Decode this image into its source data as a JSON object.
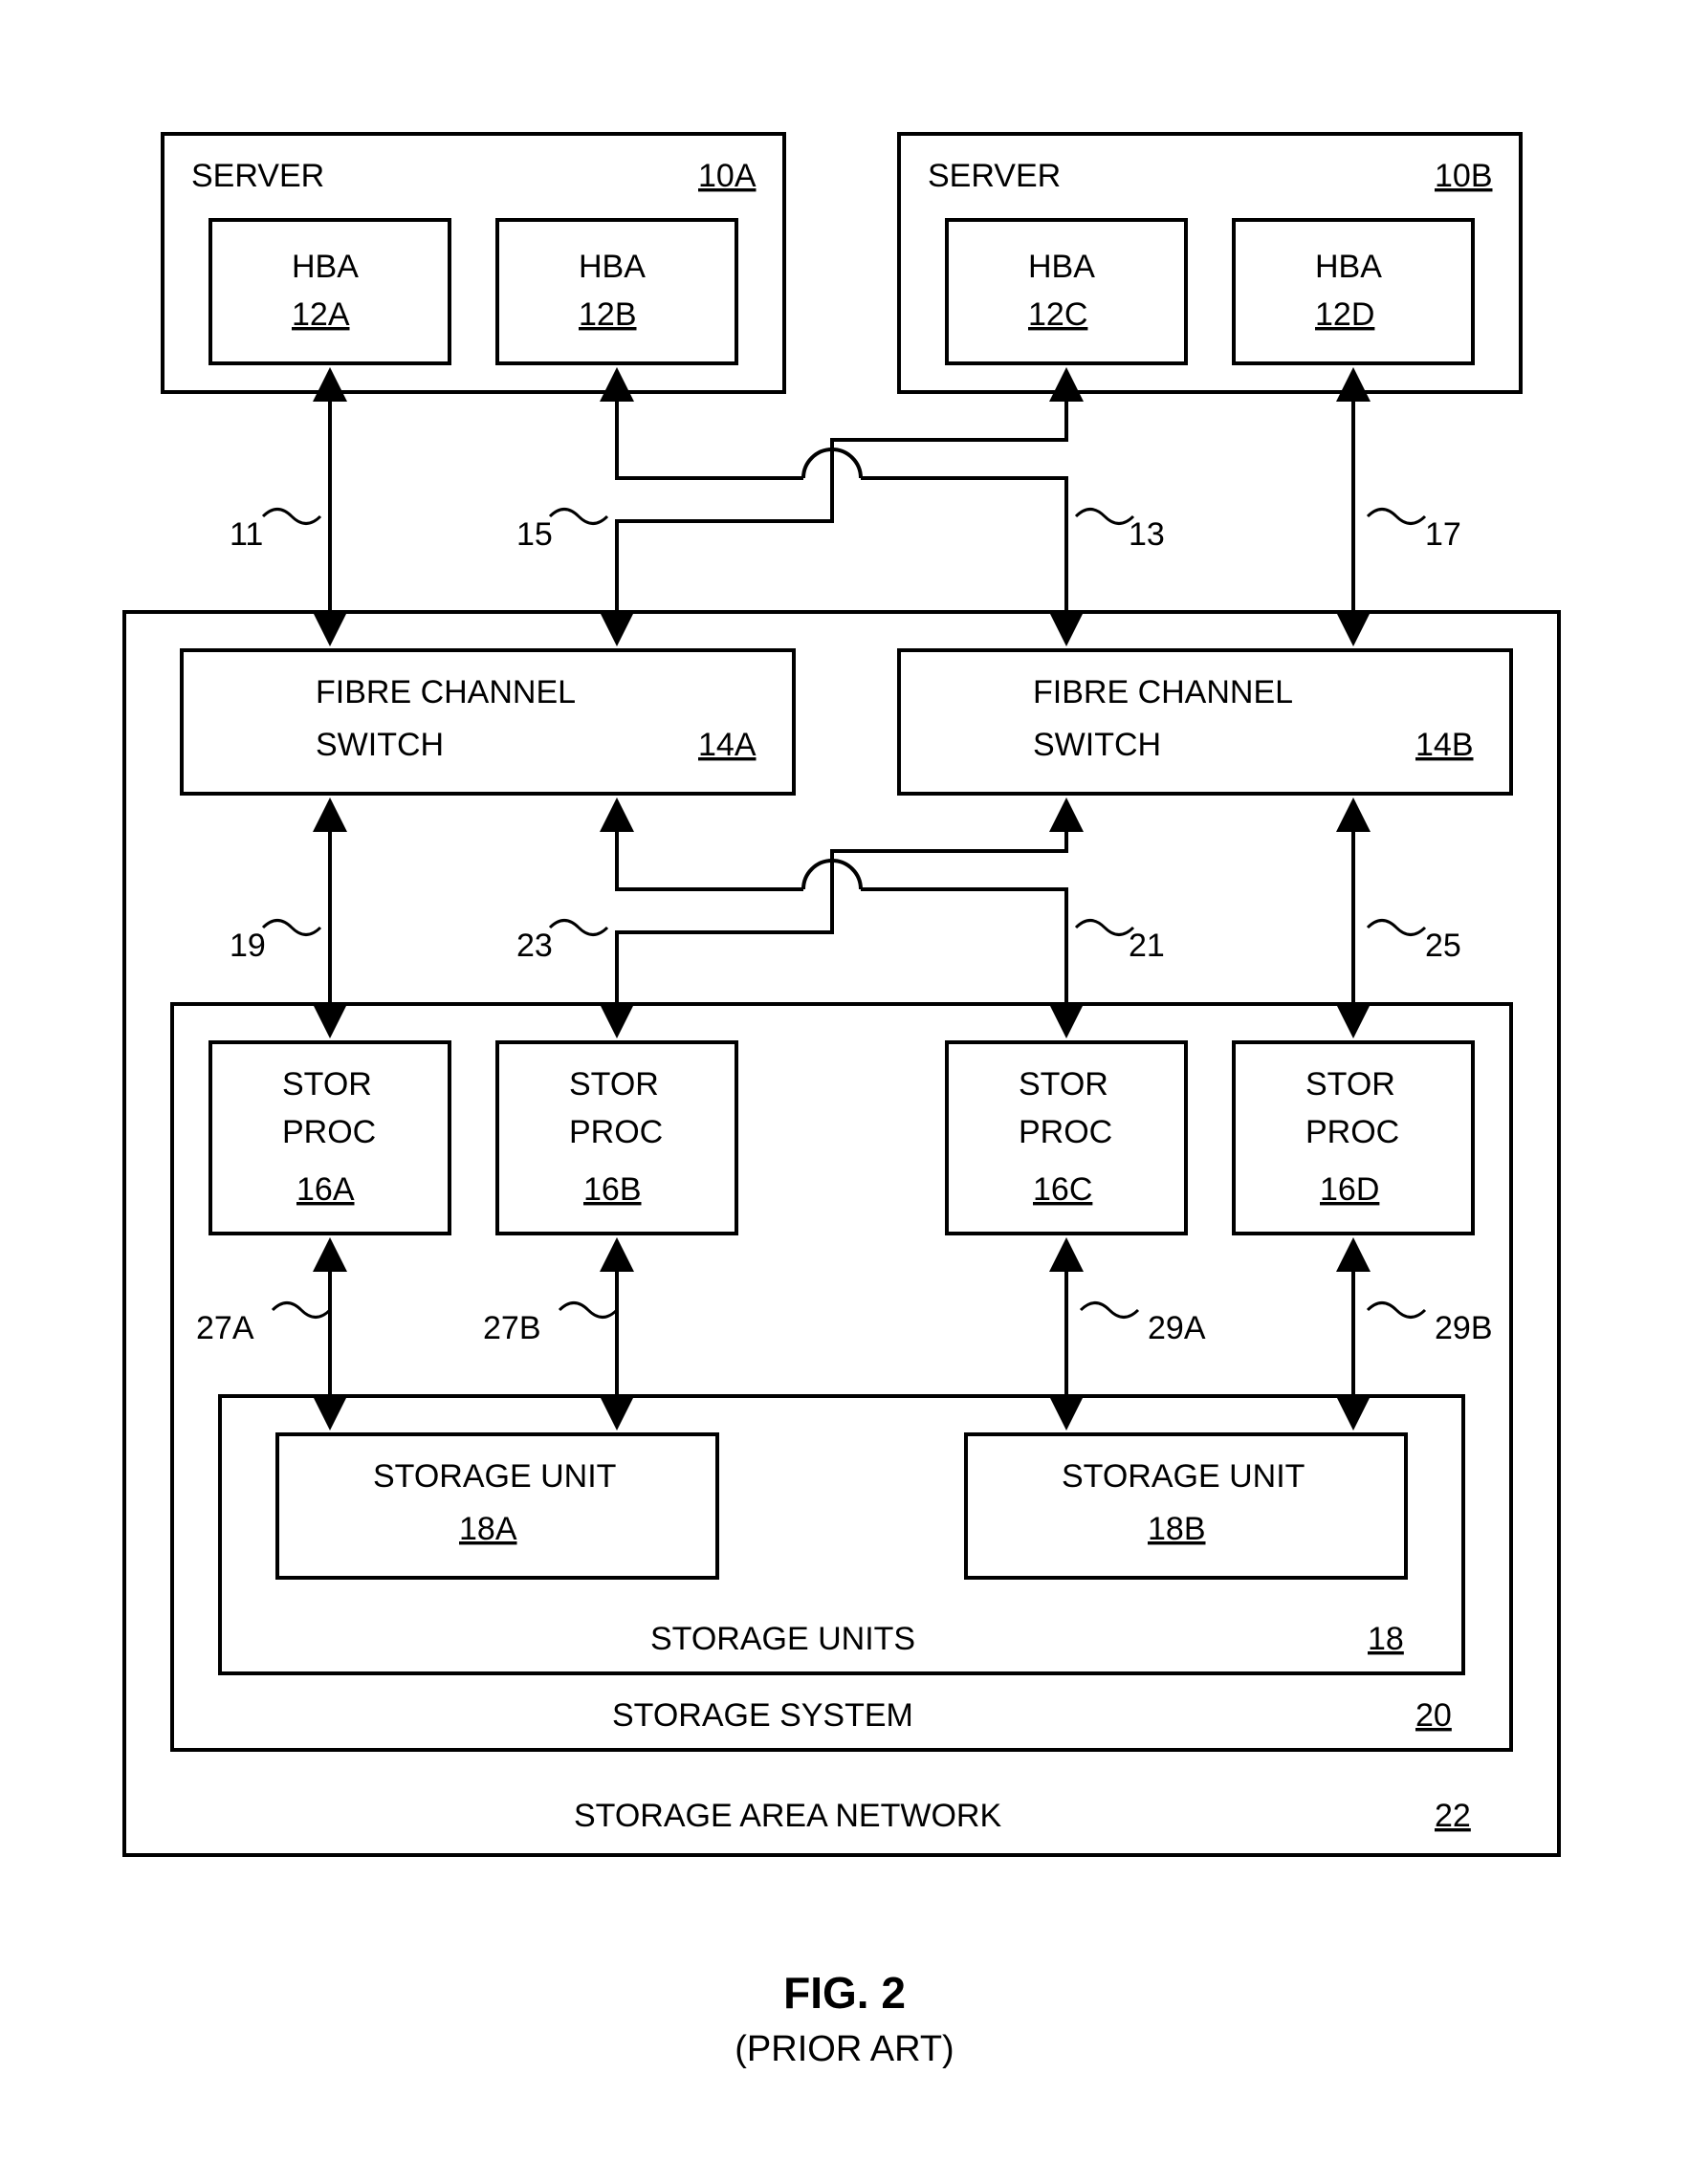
{
  "figure": {
    "title": "FIG. 2",
    "subtitle": "(PRIOR ART)"
  },
  "servers": {
    "a": {
      "label": "SERVER",
      "ref": "10A",
      "hba1": {
        "label": "HBA",
        "ref": "12A"
      },
      "hba2": {
        "label": "HBA",
        "ref": "12B"
      }
    },
    "b": {
      "label": "SERVER",
      "ref": "10B",
      "hba1": {
        "label": "HBA",
        "ref": "12C"
      },
      "hba2": {
        "label": "HBA",
        "ref": "12D"
      }
    }
  },
  "switches": {
    "a": {
      "line1": "FIBRE CHANNEL",
      "line2": "SWITCH",
      "ref": "14A"
    },
    "b": {
      "line1": "FIBRE CHANNEL",
      "line2": "SWITCH",
      "ref": "14B"
    }
  },
  "storprocs": {
    "a": {
      "line1": "STOR",
      "line2": "PROC",
      "ref": "16A"
    },
    "b": {
      "line1": "STOR",
      "line2": "PROC",
      "ref": "16B"
    },
    "c": {
      "line1": "STOR",
      "line2": "PROC",
      "ref": "16C"
    },
    "d": {
      "line1": "STOR",
      "line2": "PROC",
      "ref": "16D"
    }
  },
  "storageunits": {
    "a": {
      "label": "STORAGE UNIT",
      "ref": "18A"
    },
    "b": {
      "label": "STORAGE UNIT",
      "ref": "18B"
    },
    "group": {
      "label": "STORAGE UNITS",
      "ref": "18"
    }
  },
  "storagesystem": {
    "label": "STORAGE SYSTEM",
    "ref": "20"
  },
  "san": {
    "label": "STORAGE AREA NETWORK",
    "ref": "22"
  },
  "conn": {
    "l11": "11",
    "l15": "15",
    "l13": "13",
    "l17": "17",
    "l19": "19",
    "l23": "23",
    "l21": "21",
    "l25": "25",
    "l27a": "27A",
    "l27b": "27B",
    "l29a": "29A",
    "l29b": "29B"
  }
}
